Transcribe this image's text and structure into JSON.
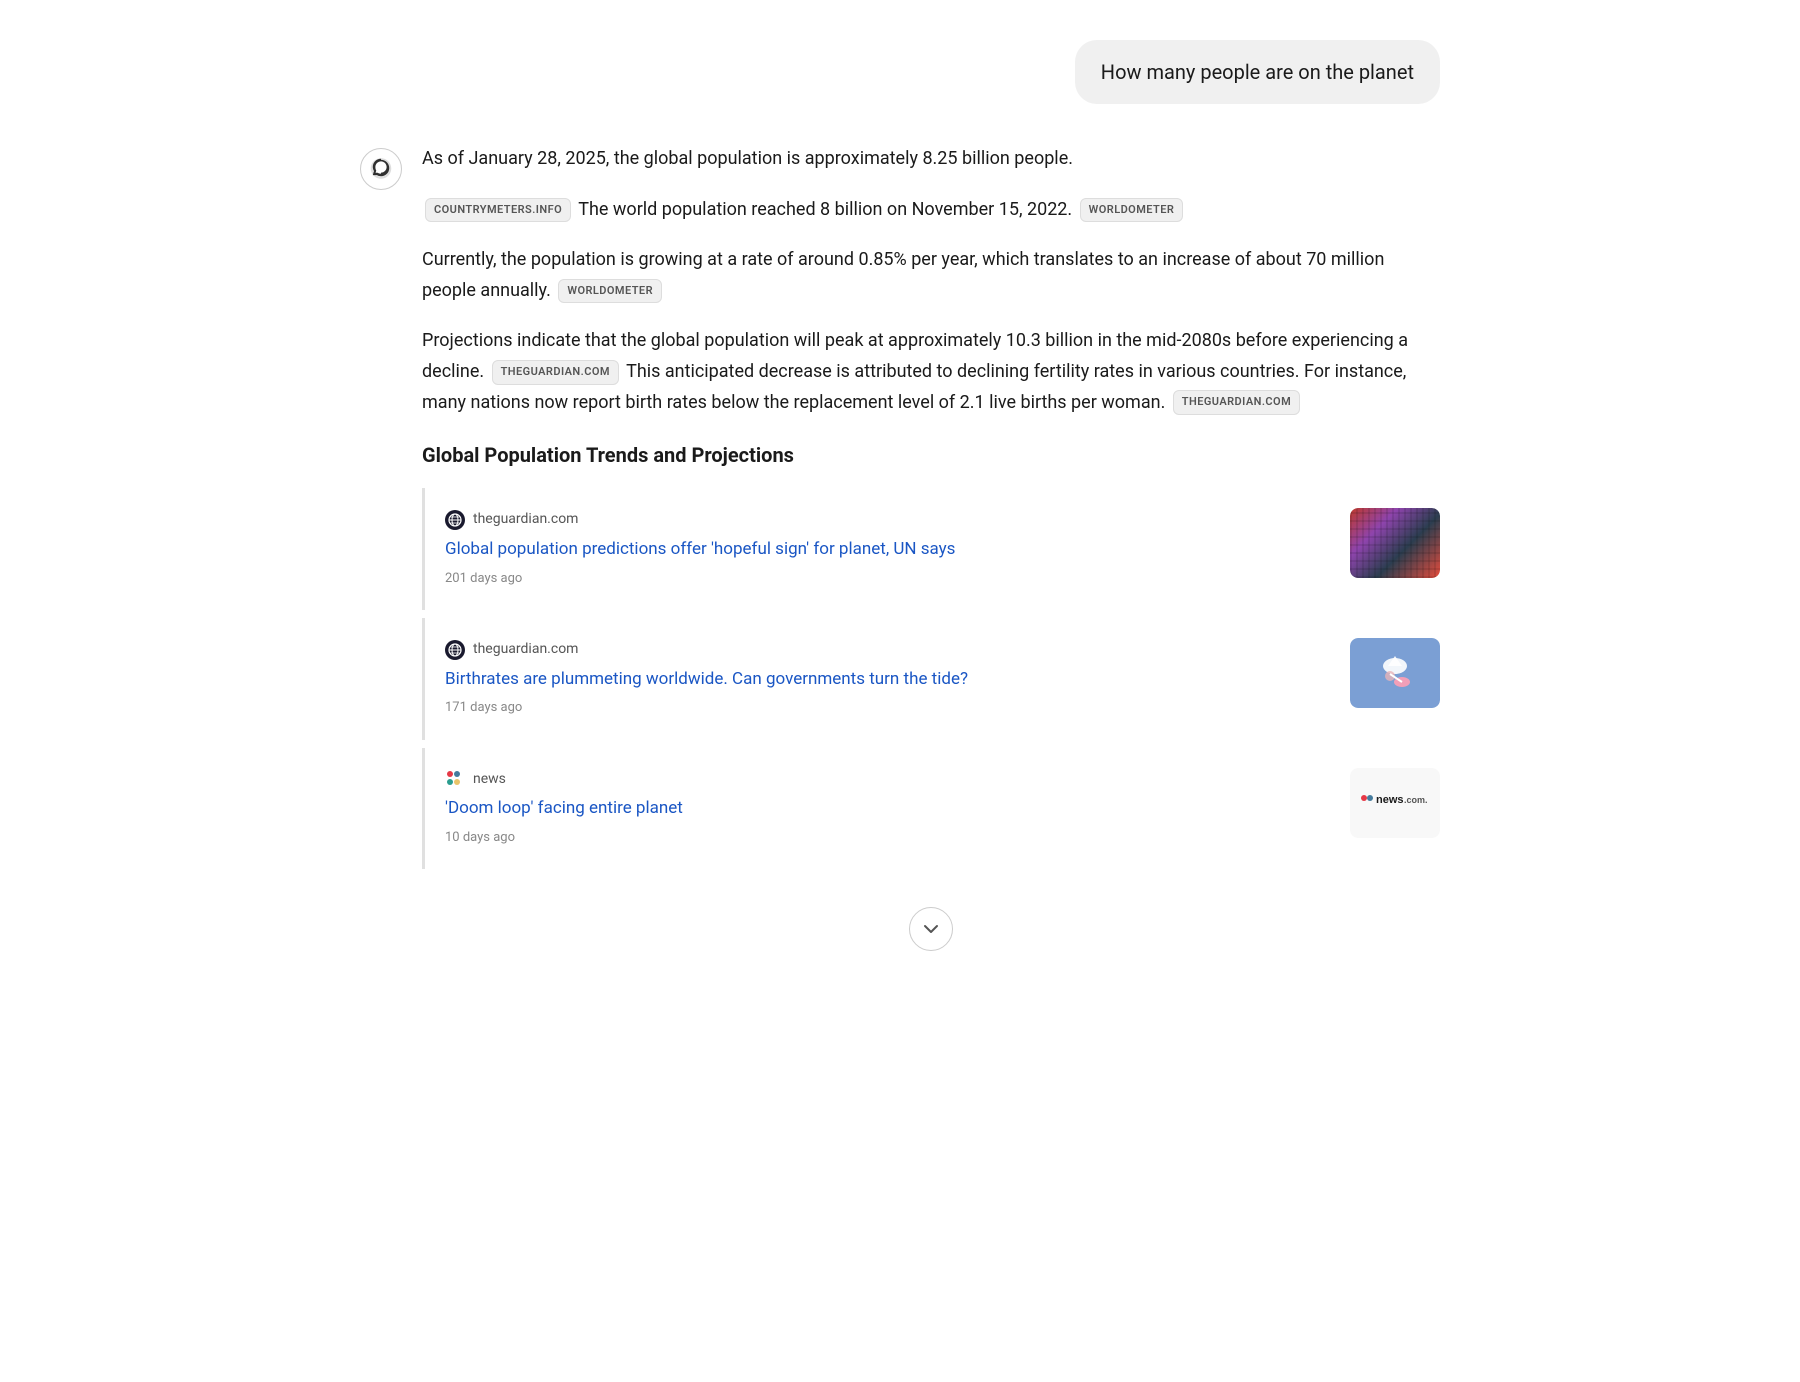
{
  "user_message": {
    "text": "How many people are on the planet"
  },
  "ai_response": {
    "paragraph1": "As of January 28, 2025, the global population is approximately 8.25 billion people.",
    "citation1": "COUNTRYMETERS.INFO",
    "sentence2": "The world population reached 8 billion on November 15, 2022.",
    "citation2": "WORLDOMETER",
    "paragraph2": "Currently, the population is growing at a rate of around 0.85% per year, which translates to an increase of about 70 million people annually.",
    "citation3": "WORLDOMETER",
    "paragraph3": "Projections indicate that the global population will peak at approximately 10.3 billion in the mid-2080s before experiencing a decline.",
    "citation4": "THEGUARDIAN.COM",
    "sentence4b": "This anticipated decrease is attributed to declining fertility rates in various countries. For instance, many nations now report birth rates below the replacement level of 2.1 live births per woman.",
    "citation5": "THEGUARDIAN.COM"
  },
  "section_heading": "Global Population Trends and Projections",
  "news_cards": [
    {
      "source": "theguardian.com",
      "title": "Global population predictions offer 'hopeful sign' for planet, UN says",
      "timestamp": "201 days ago",
      "has_thumbnail": true,
      "thumb_type": "crowd"
    },
    {
      "source": "theguardian.com",
      "title": "Birthrates are plummeting worldwide. Can governments turn the tide?",
      "timestamp": "171 days ago",
      "has_thumbnail": true,
      "thumb_type": "bird"
    },
    {
      "source": "news",
      "title": "'Doom loop' facing entire planet",
      "timestamp": "10 days ago",
      "has_thumbnail": true,
      "thumb_type": "news-logo"
    }
  ],
  "scroll_button": {
    "label": "Scroll down"
  }
}
